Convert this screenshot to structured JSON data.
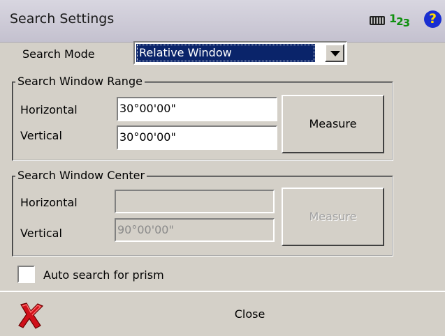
{
  "title": "Search Settings",
  "status_icons": {
    "keyboard": "keyboard-icon",
    "numeric_input": "123",
    "help": "?"
  },
  "search_mode": {
    "label": "Search Mode",
    "value": "Relative Window"
  },
  "range": {
    "group_title": "Search Window Range",
    "horizontal_label": "Horizontal",
    "horizontal_value": "30°00'00\"",
    "vertical_label": "Vertical",
    "vertical_value": "30°00'00\"",
    "measure_label": "Measure"
  },
  "center": {
    "group_title": "Search Window Center",
    "horizontal_label": "Horizontal",
    "horizontal_value": "",
    "vertical_label": "Vertical",
    "vertical_value": "90°00'00\"",
    "measure_label": "Measure"
  },
  "auto_search": {
    "label": "Auto search for prism",
    "checked": false
  },
  "footer": {
    "close_label": "Close"
  },
  "colors": {
    "selection": "#0a246a",
    "close_x": "#d0101a",
    "help_bg": "#1a2fd1",
    "numeric": "#109010"
  }
}
